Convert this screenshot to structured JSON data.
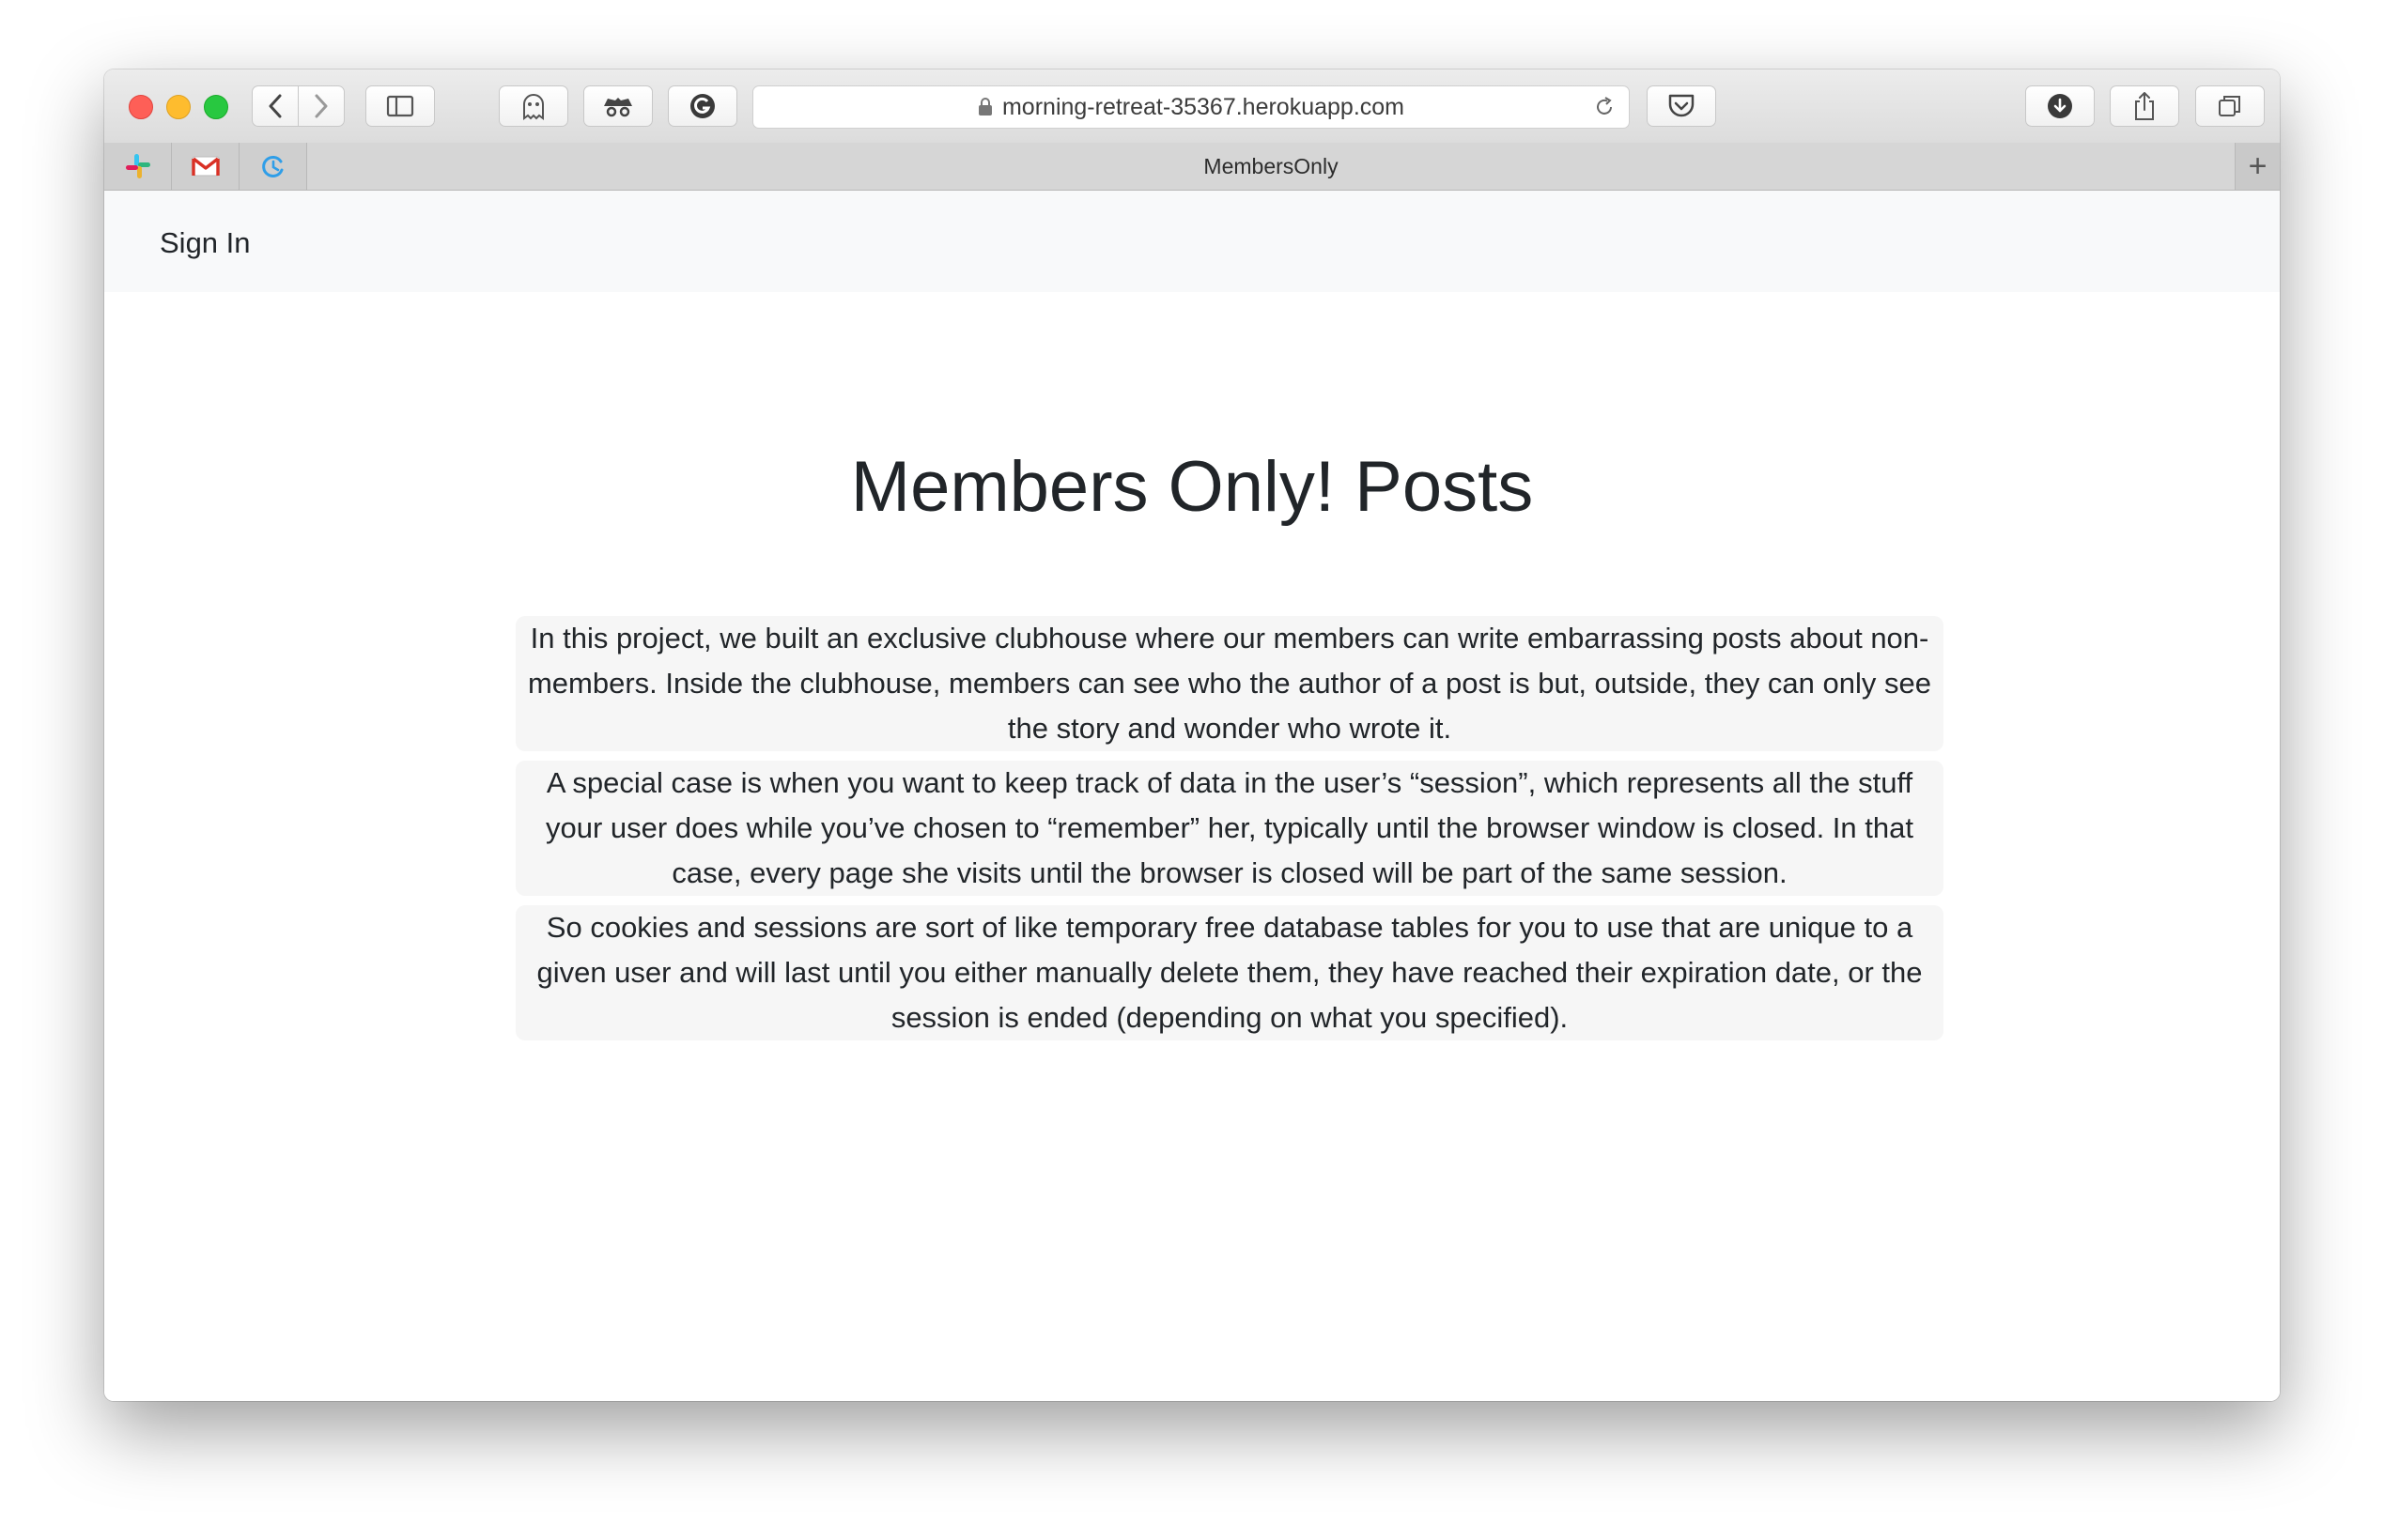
{
  "browser": {
    "url": "morning-retreat-35367.herokuapp.com",
    "tab_title": "MembersOnly",
    "new_tab_label": "+",
    "pinned_tabs": [
      "slack-icon",
      "gmail-icon",
      "refresh-app-icon"
    ],
    "toolbar_icons": [
      "back-icon",
      "forward-icon",
      "sidebar-icon",
      "ghostery-icon",
      "incognito-icon",
      "grammarly-icon",
      "pocket-icon",
      "download-icon",
      "share-icon",
      "tabs-overview-icon"
    ]
  },
  "navbar": {
    "sign_in": "Sign In"
  },
  "main": {
    "title": "Members Only! Posts",
    "posts": [
      "In this project, we built an exclusive clubhouse where our members can write embarrassing posts about non-members. Inside the clubhouse, members can see who the author of a post is but, outside, they can only see the story and wonder who wrote it.",
      "A special case is when you want to keep track of data in the user’s “session”, which represents all the stuff your user does while you’ve chosen to “remember” her, typically until the browser window is closed. In that case, every page she visits until the browser is closed will be part of the same session.",
      "So cookies and sessions are sort of like temporary free database tables for you to use that are unique to a given user and will last until you either manually delete them, they have reached their expiration date, or the session is ended (depending on what you specified)."
    ]
  },
  "colors": {
    "close": "#fe5f57",
    "minimize": "#febc2e",
    "maximize": "#28c840",
    "navbar_bg": "#f8f9fa",
    "post_bg": "#f6f6f6",
    "text": "#212529"
  }
}
